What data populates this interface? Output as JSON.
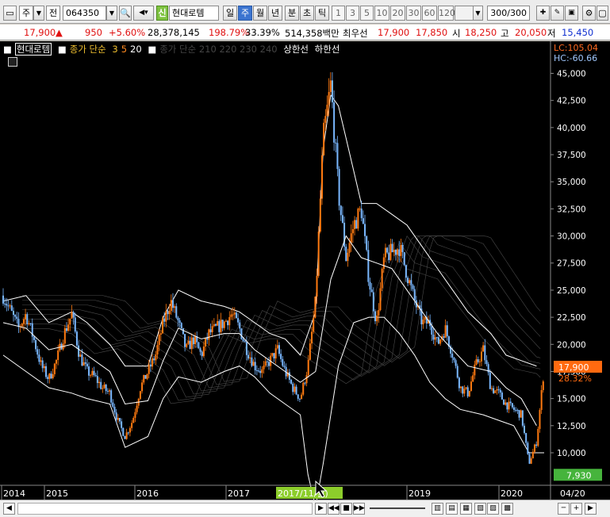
{
  "toolbar": {
    "market": "주",
    "period_prefix": "전",
    "code": "064350",
    "badge": "신",
    "name": "현대로템",
    "tabs": [
      "일",
      "주",
      "월",
      "년",
      "분",
      "초",
      "틱"
    ],
    "active_tab": "주",
    "nums": [
      "1",
      "3",
      "5",
      "10",
      "20",
      "30",
      "60",
      "120"
    ],
    "count": "300/300"
  },
  "quote": {
    "price": "17,900",
    "change_arrow": "▲",
    "change": "950",
    "change_pct": "+5.60%",
    "volume": "28,378,145",
    "volume_ratio": "198.79%",
    "turnover": "33.39%",
    "amount": "514,358백만",
    "pref_label": "최우선",
    "ask": "17,900",
    "bid": "17,850",
    "open_label": "시",
    "open": "18,250",
    "high_label": "고",
    "high": "20,050",
    "low_label": "저",
    "low": "15,450"
  },
  "legend": {
    "name": "현대로템",
    "ma_label": "종가 단순",
    "ma_periods": [
      "3",
      "5",
      "20"
    ],
    "hidden_label": "종가 단순 210 220 230 240",
    "upper": "상한선",
    "lower": "하한선",
    "lc": "LC:105.04",
    "hc": "HC:-60.66"
  },
  "chart_data": {
    "type": "candlestick",
    "y_ticks": [
      "45,000",
      "42,500",
      "40,000",
      "37,500",
      "35,000",
      "32,500",
      "30,000",
      "27,500",
      "25,000",
      "22,500",
      "20,000",
      "17,500",
      "15,000",
      "12,500",
      "10,000"
    ],
    "y_tick_values": [
      45000,
      42500,
      40000,
      37500,
      35000,
      32500,
      30000,
      27500,
      25000,
      22500,
      20000,
      17500,
      15000,
      12500,
      10000
    ],
    "ylim": [
      7000,
      46500
    ],
    "x_labels": [
      "2014",
      "2015",
      "2016",
      "2017",
      "2019",
      "2020"
    ],
    "x_highlight": "2017/11/",
    "x_highlight_suffix": "월)",
    "x_right_label": "04/20",
    "current_price": 17900,
    "current_price_label": "17,900",
    "current_pct_label": "28.32%",
    "low_marker": 7930,
    "low_marker_label": "7,930",
    "close_series": [
      [
        0,
        24500
      ],
      [
        0.02,
        23000
      ],
      [
        0.04,
        21500
      ],
      [
        0.06,
        22800
      ],
      [
        0.08,
        20500
      ],
      [
        0.1,
        18000
      ],
      [
        0.12,
        16800
      ],
      [
        0.14,
        18500
      ],
      [
        0.16,
        21000
      ],
      [
        0.18,
        22800
      ],
      [
        0.2,
        19000
      ],
      [
        0.22,
        17500
      ],
      [
        0.24,
        17000
      ],
      [
        0.26,
        16000
      ],
      [
        0.28,
        15500
      ],
      [
        0.3,
        13000
      ],
      [
        0.32,
        11500
      ],
      [
        0.34,
        13000
      ],
      [
        0.36,
        16000
      ],
      [
        0.38,
        17500
      ],
      [
        0.4,
        19000
      ],
      [
        0.42,
        22000
      ],
      [
        0.44,
        24000
      ],
      [
        0.46,
        22000
      ],
      [
        0.48,
        19500
      ],
      [
        0.5,
        20500
      ],
      [
        0.52,
        19000
      ],
      [
        0.54,
        21000
      ],
      [
        0.56,
        21500
      ],
      [
        0.58,
        22000
      ],
      [
        0.6,
        22800
      ],
      [
        0.62,
        21500
      ],
      [
        0.64,
        19500
      ],
      [
        0.66,
        18000
      ],
      [
        0.68,
        17500
      ],
      [
        0.7,
        18500
      ],
      [
        0.72,
        19500
      ],
      [
        0.74,
        17500
      ],
      [
        0.76,
        16000
      ],
      [
        0.78,
        15000
      ],
      [
        0.8,
        18000
      ],
      [
        0.82,
        24000
      ],
      [
        0.84,
        39000
      ],
      [
        0.86,
        44000
      ],
      [
        0.88,
        34000
      ],
      [
        0.9,
        28000
      ],
      [
        0.92,
        31000
      ],
      [
        0.94,
        32500
      ],
      [
        0.96,
        26000
      ],
      [
        0.98,
        22000
      ],
      [
        1.0,
        28000
      ],
      [
        1.02,
        28500
      ],
      [
        1.04,
        29000
      ],
      [
        1.06,
        26500
      ],
      [
        1.08,
        24000
      ],
      [
        1.1,
        22000
      ],
      [
        1.12,
        22000
      ],
      [
        1.14,
        20000
      ],
      [
        1.16,
        21500
      ],
      [
        1.18,
        19000
      ],
      [
        1.2,
        16000
      ],
      [
        1.22,
        15500
      ],
      [
        1.24,
        18000
      ],
      [
        1.26,
        19500
      ],
      [
        1.28,
        16000
      ],
      [
        1.3,
        15500
      ],
      [
        1.32,
        14500
      ],
      [
        1.34,
        14000
      ],
      [
        1.36,
        13500
      ],
      [
        1.38,
        9000
      ],
      [
        1.4,
        11000
      ],
      [
        1.42,
        17900
      ]
    ],
    "upper_band": [
      [
        0,
        24000
      ],
      [
        0.06,
        24500
      ],
      [
        0.12,
        22000
      ],
      [
        0.18,
        23000
      ],
      [
        0.22,
        22000
      ],
      [
        0.28,
        20000
      ],
      [
        0.32,
        18000
      ],
      [
        0.38,
        18000
      ],
      [
        0.42,
        22500
      ],
      [
        0.46,
        25000
      ],
      [
        0.52,
        24000
      ],
      [
        0.58,
        23500
      ],
      [
        0.62,
        23000
      ],
      [
        0.66,
        22000
      ],
      [
        0.7,
        21000
      ],
      [
        0.74,
        20500
      ],
      [
        0.78,
        19000
      ],
      [
        0.82,
        23000
      ],
      [
        0.84,
        38000
      ],
      [
        0.86,
        43000
      ],
      [
        0.88,
        42000
      ],
      [
        0.9,
        39000
      ],
      [
        0.92,
        36000
      ],
      [
        0.94,
        33000
      ],
      [
        0.98,
        33000
      ],
      [
        1.02,
        32000
      ],
      [
        1.06,
        31000
      ],
      [
        1.1,
        29000
      ],
      [
        1.14,
        27000
      ],
      [
        1.18,
        25000
      ],
      [
        1.22,
        23000
      ],
      [
        1.28,
        21000
      ],
      [
        1.32,
        19000
      ],
      [
        1.36,
        18500
      ],
      [
        1.4,
        18000
      ]
    ],
    "lower_band": [
      [
        0,
        19000
      ],
      [
        0.06,
        17500
      ],
      [
        0.12,
        16000
      ],
      [
        0.18,
        15500
      ],
      [
        0.22,
        15000
      ],
      [
        0.28,
        14500
      ],
      [
        0.32,
        10500
      ],
      [
        0.38,
        11500
      ],
      [
        0.42,
        15000
      ],
      [
        0.46,
        17000
      ],
      [
        0.52,
        16500
      ],
      [
        0.58,
        17500
      ],
      [
        0.62,
        18000
      ],
      [
        0.66,
        17000
      ],
      [
        0.7,
        15500
      ],
      [
        0.74,
        14500
      ],
      [
        0.78,
        13500
      ],
      [
        0.8,
        8000
      ],
      [
        0.82,
        5000
      ],
      [
        0.84,
        9000
      ],
      [
        0.88,
        18000
      ],
      [
        0.92,
        22000
      ],
      [
        0.96,
        22500
      ],
      [
        1.0,
        22500
      ],
      [
        1.04,
        21000
      ],
      [
        1.08,
        19000
      ],
      [
        1.12,
        16500
      ],
      [
        1.16,
        15000
      ],
      [
        1.2,
        14000
      ],
      [
        1.26,
        13500
      ],
      [
        1.3,
        13000
      ],
      [
        1.34,
        12500
      ],
      [
        1.38,
        10000
      ],
      [
        1.42,
        10000
      ]
    ],
    "ma20": [
      [
        0,
        22000
      ],
      [
        0.06,
        21500
      ],
      [
        0.12,
        19500
      ],
      [
        0.18,
        20000
      ],
      [
        0.22,
        19000
      ],
      [
        0.28,
        17500
      ],
      [
        0.32,
        14500
      ],
      [
        0.38,
        14800
      ],
      [
        0.42,
        18500
      ],
      [
        0.46,
        21500
      ],
      [
        0.52,
        20500
      ],
      [
        0.58,
        21000
      ],
      [
        0.62,
        21000
      ],
      [
        0.66,
        19500
      ],
      [
        0.7,
        18500
      ],
      [
        0.74,
        17500
      ],
      [
        0.78,
        16500
      ],
      [
        0.82,
        17500
      ],
      [
        0.86,
        26000
      ],
      [
        0.9,
        30000
      ],
      [
        0.94,
        28000
      ],
      [
        0.98,
        27500
      ],
      [
        1.02,
        27000
      ],
      [
        1.06,
        25000
      ],
      [
        1.1,
        23000
      ],
      [
        1.14,
        21000
      ],
      [
        1.18,
        19500
      ],
      [
        1.22,
        18000
      ],
      [
        1.28,
        17500
      ],
      [
        1.32,
        16000
      ],
      [
        1.36,
        15000
      ],
      [
        1.4,
        12500
      ]
    ]
  },
  "scrollbar": {
    "buttons": [
      "◀",
      "▶",
      "◀◀",
      "■",
      "▶▶",
      "─",
      "+"
    ]
  }
}
